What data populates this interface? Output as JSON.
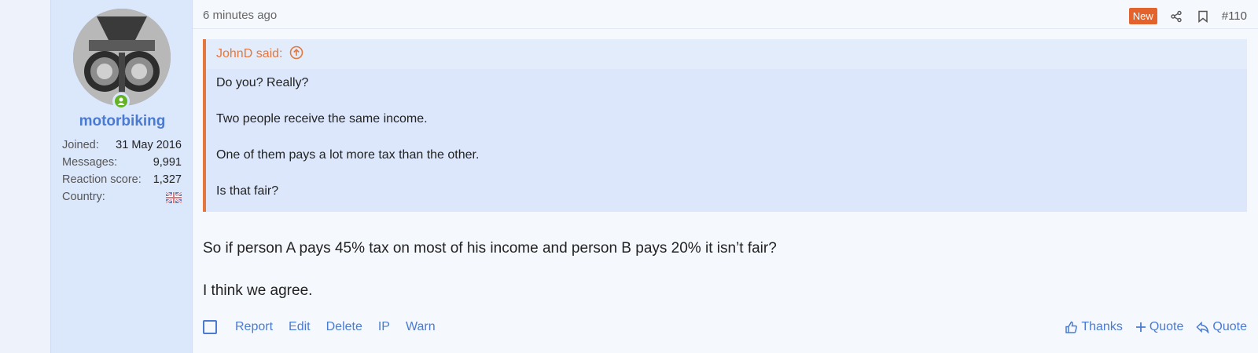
{
  "user": {
    "username": "motorbiking",
    "stats": [
      {
        "label": "Joined:",
        "value": "31 May 2016"
      },
      {
        "label": "Messages:",
        "value": "9,991"
      },
      {
        "label": "Reaction score:",
        "value": "1,327"
      }
    ],
    "country_label": "Country:",
    "country_flag": "uk-flag-icon"
  },
  "header": {
    "time": "6 minutes ago",
    "badge": "New",
    "post_number": "#110"
  },
  "quote": {
    "author": "JohnD said:",
    "lines": [
      "Do you? Really?",
      "Two people receive the same income.",
      "One of them pays a lot more tax than the other.",
      "Is that fair?"
    ]
  },
  "message": {
    "lines": [
      "So if person A pays 45% tax on most of his income and person B pays 20% it isn’t fair?",
      "I think we agree."
    ]
  },
  "actions": {
    "left": [
      "Report",
      "Edit",
      "Delete",
      "IP",
      "Warn"
    ],
    "right": {
      "thanks": "Thanks",
      "multi_quote": "Quote",
      "quote": "Quote"
    }
  },
  "colors": {
    "accent": "#4a7bd0",
    "quote_border": "#e4773e",
    "new_badge": "#e4622b",
    "online": "#63b324"
  }
}
